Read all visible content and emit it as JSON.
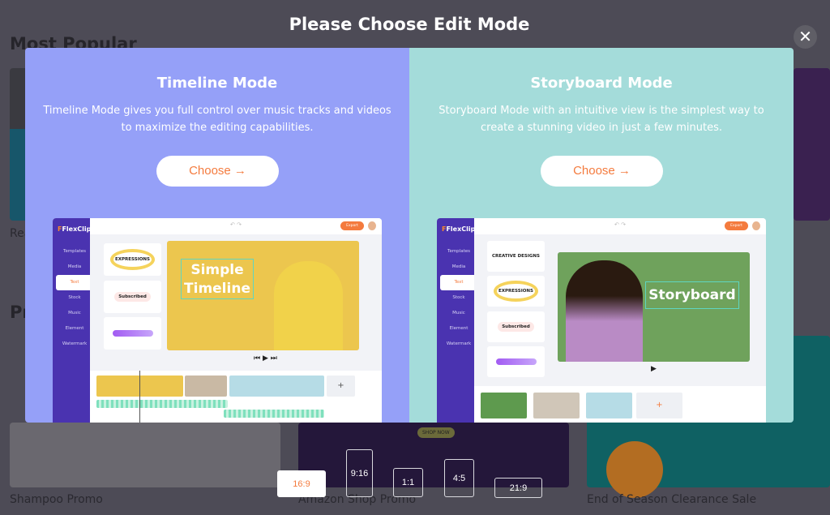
{
  "background": {
    "section_titles": [
      "Most Popular",
      "Pr"
    ],
    "card_labels": [
      "Rea",
      "Shampoo Promo",
      "Amazon Shop Promo",
      "End of Season Clearance Sale"
    ],
    "shop_now": "SHOP NOW"
  },
  "modal": {
    "title": "Please Choose Edit Mode",
    "close_icon": "close-icon",
    "timeline": {
      "title": "Timeline Mode",
      "description": "Timeline Mode gives you full control over music tracks and videos to maximize the editing capabilities.",
      "button": "Choose →",
      "preview": {
        "logo": "FlexClip",
        "menu": [
          "Templates",
          "Media",
          "Text",
          "Stock",
          "Music",
          "Element",
          "Watermark"
        ],
        "export": "Export",
        "stage_text": "Simple Timeline",
        "tiles": [
          "EXPRESSIONS",
          "Subscribed"
        ],
        "add": "+"
      }
    },
    "storyboard": {
      "title": "Storyboard Mode",
      "description": "Storyboard Mode with an intuitive view is the simplest way to create a stunning video in just a few minutes.",
      "button": "Choose →",
      "preview": {
        "logo": "FlexClip",
        "menu": [
          "Templates",
          "Media",
          "Text",
          "Stock",
          "Music",
          "Element",
          "Watermark"
        ],
        "export": "Export",
        "stage_text": "Storyboard",
        "tiles": [
          "CREATIVE DESIGNS",
          "EXPRESSIONS",
          "Subscribed"
        ],
        "add": "+"
      }
    }
  },
  "aspect_ratios": {
    "options": [
      "16:9",
      "9:16",
      "1:1",
      "4:5",
      "21:9"
    ],
    "selected": "16:9"
  },
  "colors": {
    "timeline_bg": "#95a0f8",
    "storyboard_bg": "#a4dcda",
    "accent": "#f47b3e"
  }
}
